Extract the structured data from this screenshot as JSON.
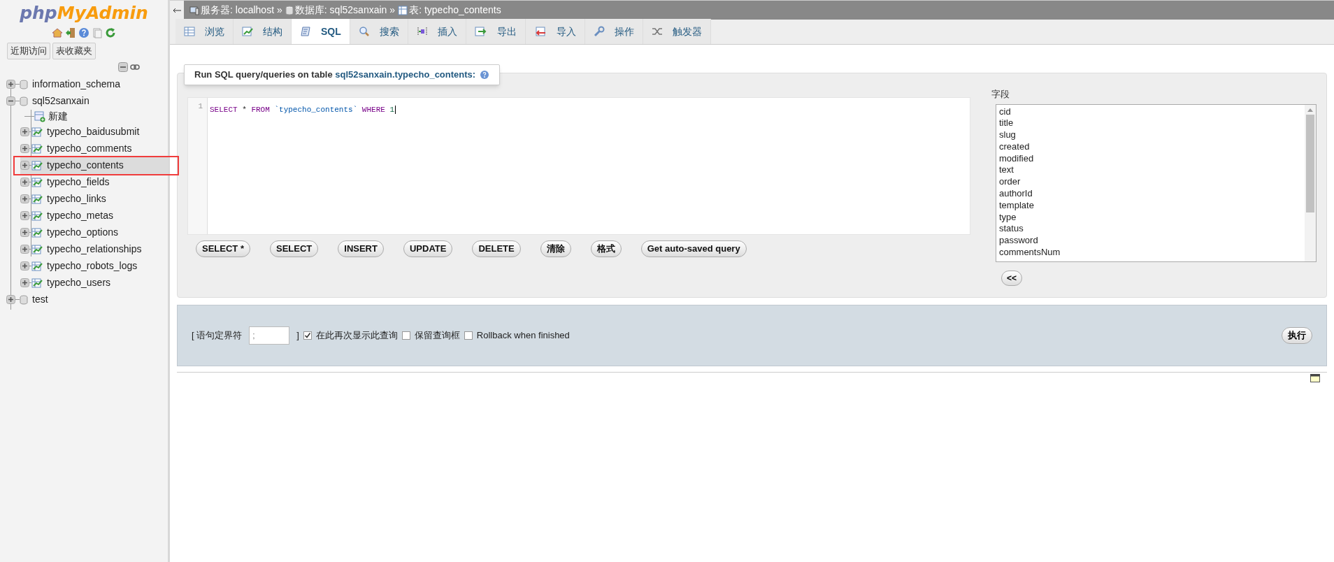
{
  "sidebar": {
    "logo_left": "php",
    "logo_right": "MyAdmin",
    "quick_buttons": [
      "近期访问",
      "表收藏夹"
    ],
    "tree": [
      {
        "label": "information_schema",
        "kind": "database",
        "expanded": false
      },
      {
        "label": "sql52sanxain",
        "kind": "database",
        "expanded": true,
        "children": [
          {
            "label": "新建",
            "kind": "new"
          },
          {
            "label": "typecho_baidusubmit",
            "kind": "table",
            "selected": false,
            "marked": false
          },
          {
            "label": "typecho_comments",
            "kind": "table",
            "selected": false,
            "marked": false
          },
          {
            "label": "typecho_contents",
            "kind": "table",
            "selected": true,
            "marked": true
          },
          {
            "label": "typecho_fields",
            "kind": "table",
            "selected": false,
            "marked": false
          },
          {
            "label": "typecho_links",
            "kind": "table",
            "selected": false,
            "marked": false
          },
          {
            "label": "typecho_metas",
            "kind": "table",
            "selected": false,
            "marked": false
          },
          {
            "label": "typecho_options",
            "kind": "table",
            "selected": false,
            "marked": false
          },
          {
            "label": "typecho_relationships",
            "kind": "table",
            "selected": false,
            "marked": false
          },
          {
            "label": "typecho_robots_logs",
            "kind": "table",
            "selected": false,
            "marked": false
          },
          {
            "label": "typecho_users",
            "kind": "table",
            "selected": false,
            "marked": false
          }
        ]
      },
      {
        "label": "test",
        "kind": "database",
        "expanded": false
      }
    ]
  },
  "breadcrumb": [
    {
      "kind": "server",
      "text": "服务器: localhost"
    },
    {
      "kind": "database",
      "text": "数据库: sql52sanxain"
    },
    {
      "kind": "table",
      "text": "表: typecho_contents"
    }
  ],
  "breadcrumb_separator": "»",
  "tabs": [
    {
      "label": "浏览",
      "kind": "browse",
      "selected": false
    },
    {
      "label": "结构",
      "kind": "structure",
      "selected": false
    },
    {
      "label": "SQL",
      "kind": "sql",
      "selected": true
    },
    {
      "label": "搜索",
      "kind": "search",
      "selected": false
    },
    {
      "label": "插入",
      "kind": "insert",
      "selected": false
    },
    {
      "label": "导出",
      "kind": "export",
      "selected": false
    },
    {
      "label": "导入",
      "kind": "import",
      "selected": false
    },
    {
      "label": "操作",
      "kind": "operations",
      "selected": false
    },
    {
      "label": "触发器",
      "kind": "triggers",
      "selected": false
    }
  ],
  "query_panel": {
    "legend_prefix": "Run SQL query/queries on table ",
    "legend_table": "sql52sanxain.typecho_contents:",
    "editor": {
      "line_number": "1",
      "tokens": [
        {
          "kind": "keyword",
          "text": "SELECT"
        },
        {
          "kind": "plain",
          "text": " * "
        },
        {
          "kind": "keyword",
          "text": "FROM"
        },
        {
          "kind": "string",
          "text": " `typecho_contents` "
        },
        {
          "kind": "keyword",
          "text": "WHERE"
        },
        {
          "kind": "number",
          "text": " 1"
        }
      ]
    },
    "buttons": [
      "SELECT *",
      "SELECT",
      "INSERT",
      "UPDATE",
      "DELETE",
      "清除",
      "格式",
      "Get auto-saved query"
    ],
    "fields_label": "字段",
    "fields": [
      "cid",
      "title",
      "slug",
      "created",
      "modified",
      "text",
      "order",
      "authorId",
      "template",
      "type",
      "status",
      "password",
      "commentsNum"
    ],
    "insert_button": "<<"
  },
  "options_bar": {
    "delimiter_open": "[ 语句定界符",
    "delimiter_value": ";",
    "delimiter_close": "]",
    "checkboxes": [
      {
        "label": "在此再次显示此查询",
        "checked": true
      },
      {
        "label": "保留查询框",
        "checked": false
      },
      {
        "label": "Rollback when finished",
        "checked": false
      }
    ],
    "go_button": "执行"
  }
}
